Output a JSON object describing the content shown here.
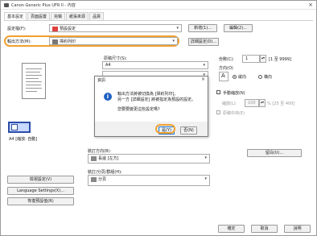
{
  "window": {
    "title": "Canon Generic Plus UFR II - 內容",
    "close": "×"
  },
  "tabs": [
    "基本設定",
    "頁面設置",
    "完稿",
    "紙張來源",
    "品質"
  ],
  "profile": {
    "label": "設定檔(F):",
    "value": "預設設定",
    "add": "新增(1)...",
    "edit": "編輯(2)..."
  },
  "output": {
    "label": "輸出方法(M):",
    "value": "擇約列印",
    "details": "詳細設定(D)..."
  },
  "preview": {
    "caption": "A4 [縮放: 自動]"
  },
  "left_buttons": {
    "check": "檢視設定(V)",
    "language": "Language Settings(X)...",
    "restore": "恢復預設值(R)"
  },
  "page_size": {
    "label": "原稿尺寸(S):",
    "value": "A4"
  },
  "copies": {
    "label": "份數(C):",
    "value": "1",
    "range": "[1 至 9999]"
  },
  "orientation": {
    "label": "方向(O)",
    "portrait": "縱向",
    "landscape": "橫向",
    "letter": "A"
  },
  "manual_scaling": {
    "label": "手動縮放(N)",
    "scaling_label": "縮放(L):",
    "value": "100",
    "range": "% [25 至 400]"
  },
  "duplex_center": {
    "label": "原稿中央(E)"
  },
  "binding": {
    "label": "裝訂方向(B):",
    "value": "長邊 [左方]"
  },
  "finishing": {
    "label": "裝訂/分頁/群組(H):",
    "value": "分頁"
  },
  "margin_button": "留白(U)...",
  "footer": {
    "ok": "確定",
    "cancel": "取消",
    "help": "說明"
  },
  "dialog": {
    "title": "資訊",
    "close": "×",
    "line1": "輸出方法將被切換為 [擇約列印]。",
    "line2": "另一方 [詳細設定] 將被指定為預設的設定。",
    "line3": "您要要變更這些設定嗎?",
    "yes": "是(Y)",
    "no": "否(N)"
  }
}
